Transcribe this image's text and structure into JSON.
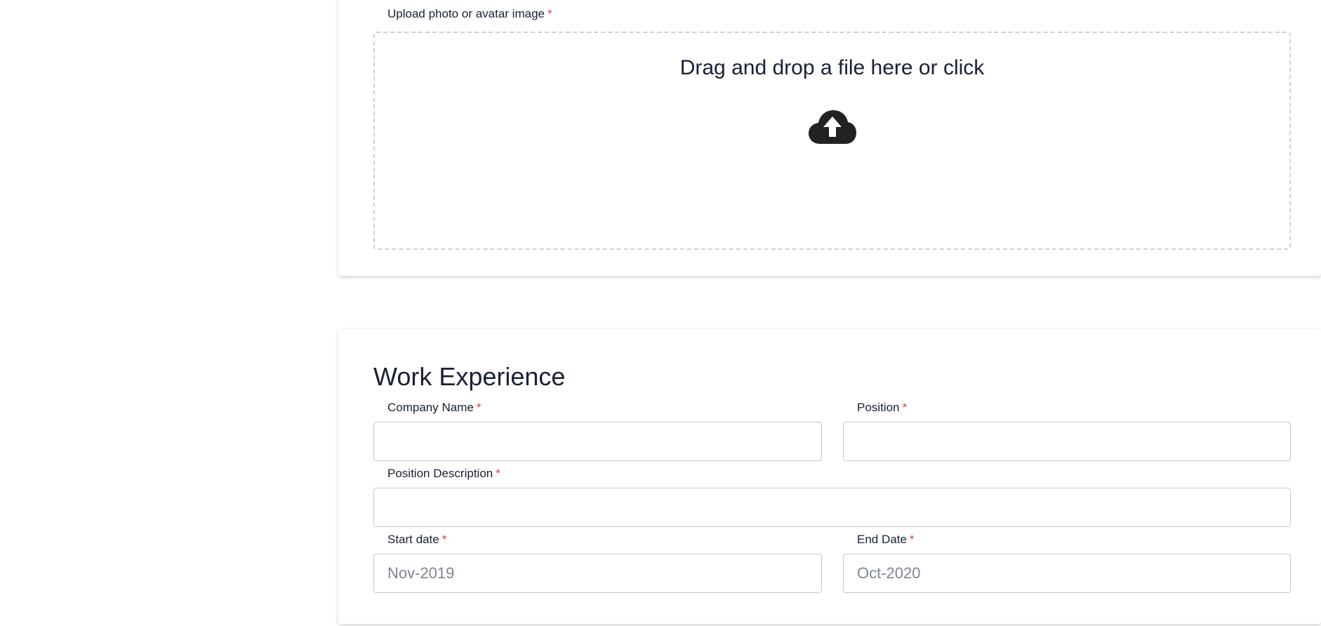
{
  "upload": {
    "label": "Upload photo or avatar image",
    "required_marker": "*",
    "dropzone_text": "Drag and drop a file here or click",
    "icon": "cloud-upload-icon"
  },
  "work_experience": {
    "title": "Work Experience",
    "company_name": {
      "label": "Company Name",
      "required_marker": "*",
      "value": "",
      "placeholder": ""
    },
    "position": {
      "label": "Position",
      "required_marker": "*",
      "value": "",
      "placeholder": ""
    },
    "position_description": {
      "label": "Position Description",
      "required_marker": "*",
      "value": "",
      "placeholder": ""
    },
    "start_date": {
      "label": "Start date",
      "required_marker": "*",
      "value": "",
      "placeholder": "Nov-2019"
    },
    "end_date": {
      "label": "End Date",
      "required_marker": "*",
      "value": "",
      "placeholder": "Oct-2020"
    }
  },
  "colors": {
    "text": "#1a2035",
    "required": "#e53935",
    "border": "#c6c8cc",
    "dropzone_border": "#cfd0d4",
    "placeholder": "#808592"
  }
}
